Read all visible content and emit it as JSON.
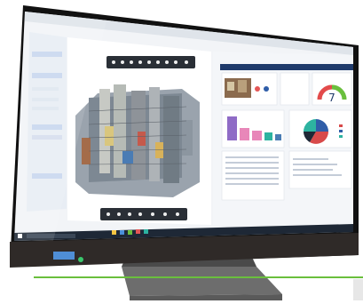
{
  "left_pane": {
    "search_placeholder": "",
    "panel_items": [
      "",
      "",
      "",
      "",
      ""
    ]
  },
  "right_pane": {
    "title": "",
    "gauge_value": "7"
  },
  "taskbar": {
    "search_placeholder": ""
  },
  "colors": {
    "bezel": "#1a1a1a",
    "taskbar": "#1e2836",
    "accent_green": "#6abf3d",
    "chart_purple": "#8f6bc6",
    "chart_pink": "#e887b9",
    "chart_red": "#d84a4a",
    "chart_blue": "#2f5da8",
    "chart_teal": "#2db3a0"
  }
}
